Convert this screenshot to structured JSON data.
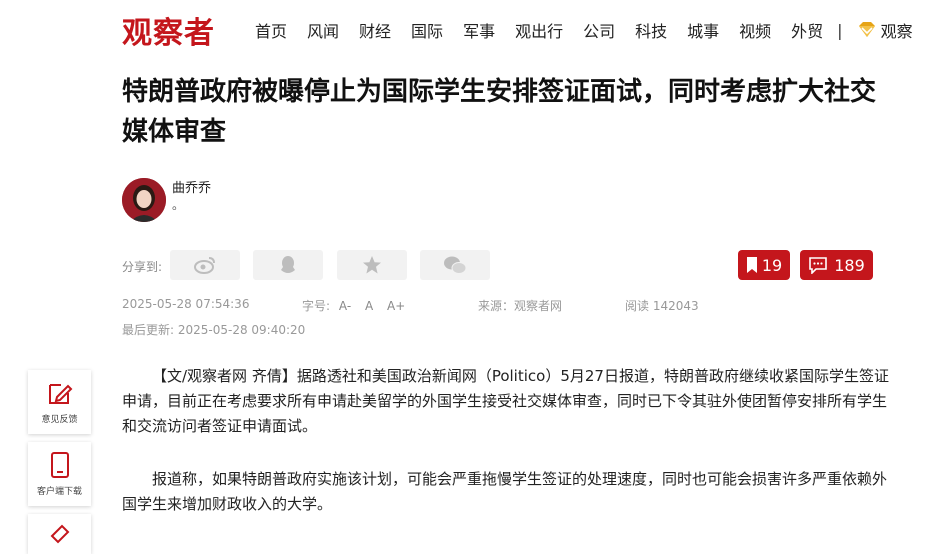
{
  "site": {
    "logo": "观察者"
  },
  "nav": {
    "items": [
      "首页",
      "风闻",
      "财经",
      "国际",
      "军事",
      "观出行",
      "公司",
      "科技",
      "城事",
      "视频",
      "外贸"
    ],
    "separator": "|",
    "vip_label": "观察"
  },
  "article": {
    "title": "特朗普政府被曝停止为国际学生安排签证面试，同时考虑扩大社交媒体审查",
    "author": {
      "name": "曲乔乔",
      "desc": "。"
    },
    "share_label": "分享到:",
    "bookmark_count": "19",
    "comment_count": "189",
    "meta": {
      "date": "2025-05-28 07:54:36",
      "font_label": "字号:",
      "font_small": "A-",
      "font_normal": "A",
      "font_large": "A+",
      "source": "来源：观察者网",
      "reads": "阅读 142043",
      "updated": "最后更新: 2025-05-28 09:40:20"
    },
    "paragraphs": [
      "【文/观察者网 齐倩】据路透社和美国政治新闻网（Politico）5月27日报道，特朗普政府继续收紧国际学生签证申请，目前正在考虑要求所有申请赴美留学的外国学生接受社交媒体审查，同时已下令其驻外使团暂停安排所有学生和交流访问者签证申请面试。",
      "报道称，如果特朗普政府实施该计划，可能会严重拖慢学生签证的处理速度，同时也可能会损害许多严重依赖外国学生来增加财政收入的大学。"
    ]
  },
  "sidebar_tools": {
    "feedback": "意见反馈",
    "app_download": "客户端下载"
  },
  "colors": {
    "brand_red": "#c4161c",
    "vip_gold": "#e6a417"
  },
  "icons": [
    "weibo-icon",
    "qq-icon",
    "qzone-icon",
    "wechat-icon",
    "bookmark-icon",
    "comment-icon",
    "edit-icon",
    "phone-icon"
  ]
}
